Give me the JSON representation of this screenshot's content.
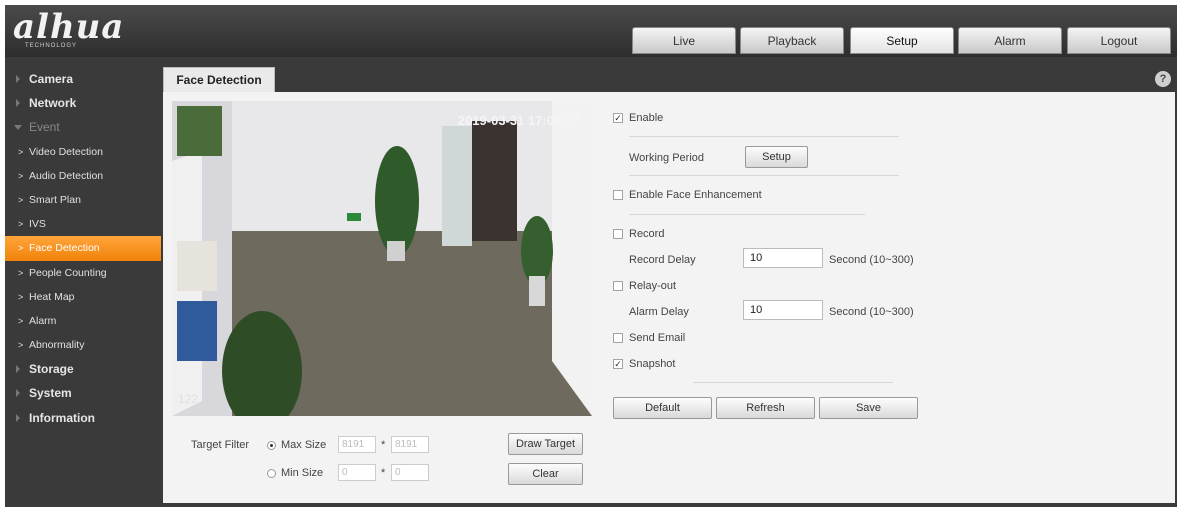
{
  "header": {
    "logo_text": "alhua",
    "logo_sub": "TECHNOLOGY",
    "tabs": [
      {
        "label": "Live"
      },
      {
        "label": "Playback"
      },
      {
        "label": "Setup"
      },
      {
        "label": "Alarm"
      },
      {
        "label": "Logout"
      }
    ],
    "active_tab": "Setup"
  },
  "sidebar": {
    "items": [
      {
        "label": "Camera",
        "level": "top"
      },
      {
        "label": "Network",
        "level": "top"
      },
      {
        "label": "Event",
        "level": "top",
        "expanded": true
      },
      {
        "label": "Video Detection",
        "level": "sub"
      },
      {
        "label": "Audio Detection",
        "level": "sub"
      },
      {
        "label": "Smart Plan",
        "level": "sub"
      },
      {
        "label": "IVS",
        "level": "sub"
      },
      {
        "label": "Face Detection",
        "level": "sub",
        "active": true
      },
      {
        "label": "People Counting",
        "level": "sub"
      },
      {
        "label": "Heat Map",
        "level": "sub"
      },
      {
        "label": "Alarm",
        "level": "sub"
      },
      {
        "label": "Abnormality",
        "level": "sub"
      },
      {
        "label": "Storage",
        "level": "top"
      },
      {
        "label": "System",
        "level": "top"
      },
      {
        "label": "Information",
        "level": "top"
      }
    ]
  },
  "page": {
    "title": "Face Detection",
    "help_icon": "?"
  },
  "video": {
    "osd_time": "2019-03-31 17:06:07",
    "osd_number": "122"
  },
  "target_filter": {
    "label": "Target Filter",
    "max_size_label": "Max Size",
    "max_w": "8191",
    "max_h": "8191",
    "min_size_label": "Min Size",
    "min_w": "0",
    "min_h": "0",
    "times": "*",
    "selected": "max",
    "draw_target_label": "Draw Target",
    "clear_label": "Clear"
  },
  "settings": {
    "enable_label": "Enable",
    "enable_checked": true,
    "working_period_label": "Working Period",
    "setup_button": "Setup",
    "face_enhancement_label": "Enable Face Enhancement",
    "face_enhancement_checked": false,
    "record_label": "Record",
    "record_checked": false,
    "record_delay_label": "Record Delay",
    "record_delay_value": "10",
    "record_delay_unit": "Second (10~300)",
    "relay_out_label": "Relay-out",
    "relay_out_checked": false,
    "alarm_delay_label": "Alarm Delay",
    "alarm_delay_value": "10",
    "alarm_delay_unit": "Second (10~300)",
    "send_email_label": "Send Email",
    "send_email_checked": false,
    "snapshot_label": "Snapshot",
    "snapshot_checked": true
  },
  "actions": {
    "default_label": "Default",
    "refresh_label": "Refresh",
    "save_label": "Save"
  },
  "colors": {
    "accent": "#f08a14",
    "header_bg": "#3a3a3a",
    "panel_bg": "#f3f3f3"
  }
}
